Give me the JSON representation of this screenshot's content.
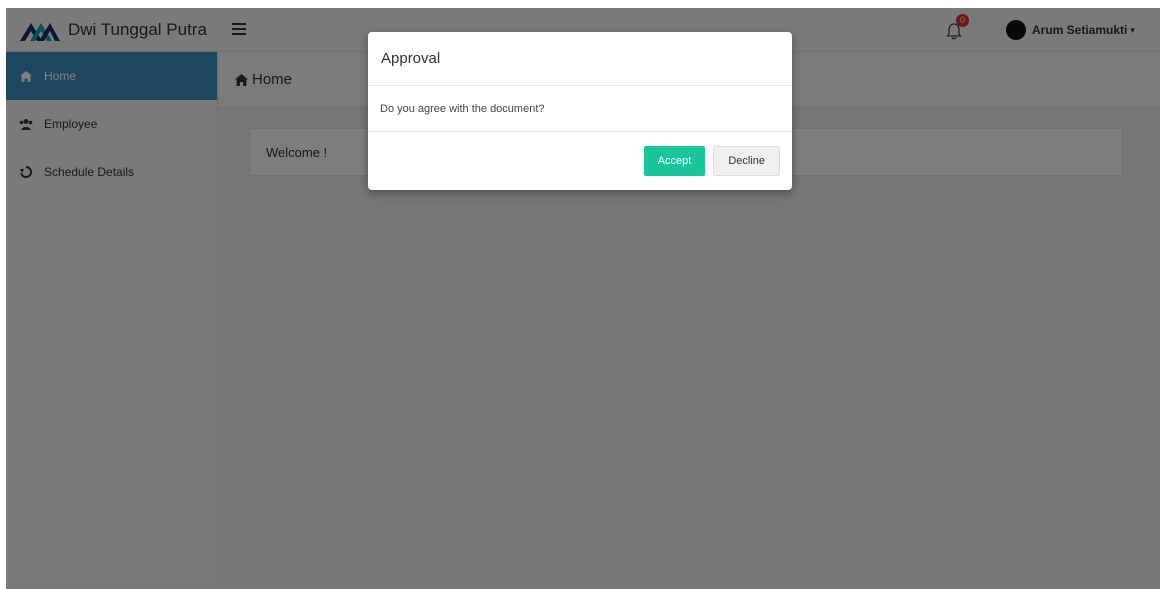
{
  "brand": {
    "name": "Dwi Tunggal Putra",
    "logo_icon": "mountain-logo-icon",
    "logo_color_dark": "#16306b",
    "logo_color_accent": "#16a7a5"
  },
  "header": {
    "menu_icon": "hamburger-icon",
    "notification_count": "0",
    "user_name": "Arum Setiamukti",
    "caret": "▾"
  },
  "sidebar": {
    "items": [
      {
        "label": "Home",
        "icon": "home-icon",
        "active": true
      },
      {
        "label": "Employee",
        "icon": "users-icon",
        "active": false
      },
      {
        "label": "Schedule Details",
        "icon": "refresh-icon",
        "active": false
      }
    ]
  },
  "content": {
    "page_title": "Home",
    "welcome_text": "Welcome !"
  },
  "modal": {
    "title": "Approval",
    "message": "Do you agree with the document?",
    "accept_label": "Accept",
    "decline_label": "Decline"
  },
  "colors": {
    "primary": "#3c8dbc",
    "accept": "#19c69b",
    "badge": "#e0312f"
  }
}
